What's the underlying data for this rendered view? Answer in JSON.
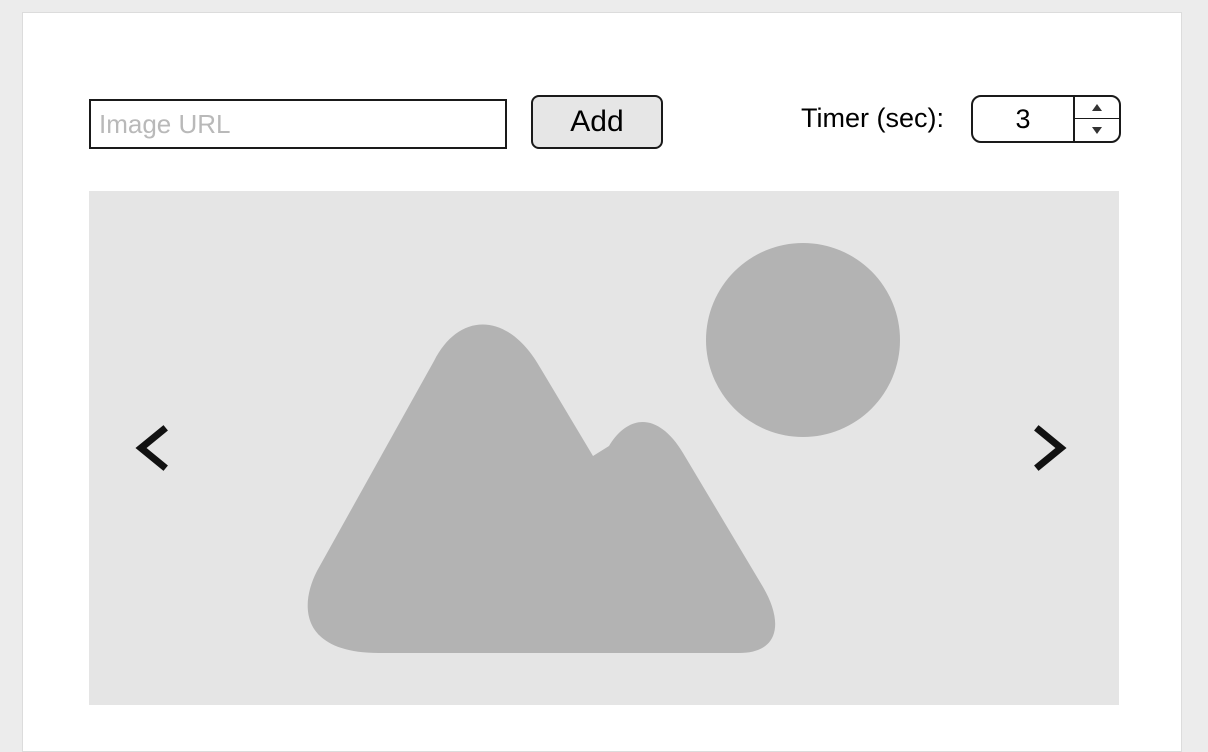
{
  "toolbar": {
    "url_placeholder": "Image URL",
    "url_value": "",
    "add_label": "Add",
    "timer_label": "Timer (sec):",
    "timer_value": "3"
  },
  "viewer": {
    "image_icon": "image-placeholder-icon",
    "prev_icon": "chevron-left-icon",
    "next_icon": "chevron-right-icon"
  },
  "colors": {
    "background": "#ececec",
    "panel": "#ffffff",
    "viewer_bg": "#e5e5e5",
    "placeholder_shape": "#b3b3b3",
    "border": "#1a1a1a"
  }
}
